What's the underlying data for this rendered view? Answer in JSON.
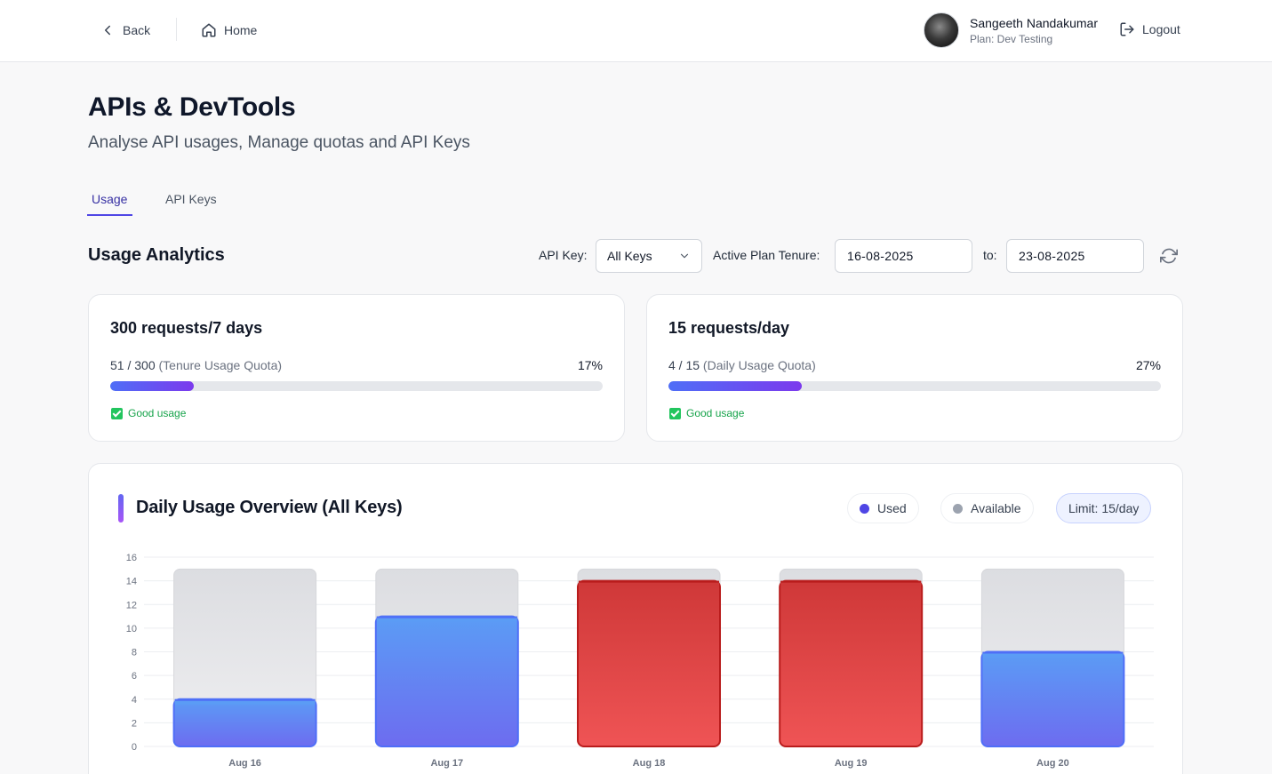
{
  "nav": {
    "back_label": "Back",
    "home_label": "Home",
    "user_name": "Sangeeth Nandakumar",
    "user_plan": "Plan: Dev Testing",
    "logout_label": "Logout"
  },
  "page": {
    "title": "APIs & DevTools",
    "subtitle": "Analyse API usages, Manage quotas and API Keys"
  },
  "tabs": [
    {
      "label": "Usage",
      "active": true
    },
    {
      "label": "API Keys",
      "active": false
    }
  ],
  "analytics": {
    "title": "Usage Analytics",
    "api_key_label": "API Key:",
    "api_key_value": "All Keys",
    "tenure_label": "Active Plan Tenure:",
    "from_date": "16-08-2025",
    "to_label": "to:",
    "to_date": "23-08-2025"
  },
  "cards": [
    {
      "title": "300 requests/7 days",
      "used": "51 / 300",
      "quota_label": "(Tenure Usage Quota)",
      "percent_label": "17%",
      "percent": 17,
      "status": "Good usage"
    },
    {
      "title": "15 requests/day",
      "used": "4 / 15",
      "quota_label": "(Daily Usage Quota)",
      "percent_label": "27%",
      "percent": 27,
      "status": "Good usage"
    }
  ],
  "daily_chart": {
    "title": "Daily Usage Overview (All Keys)",
    "legend_used": "Used",
    "legend_available": "Available",
    "limit_label": "Limit: 15/day"
  },
  "colors": {
    "used": "#4f6ef7",
    "available": "#9ca3af",
    "over": "#dc2626",
    "accent": "#4f46e5",
    "good": "#16a34a"
  },
  "chart_data": {
    "type": "bar",
    "stacked": true,
    "categories": [
      "Aug 16",
      "Aug 17",
      "Aug 18",
      "Aug 19",
      "Aug 20"
    ],
    "series": [
      {
        "name": "Used",
        "values": [
          4,
          11,
          14,
          14,
          8
        ]
      },
      {
        "name": "Available",
        "values": [
          11,
          4,
          1,
          1,
          7
        ]
      }
    ],
    "high_usage_days": [
      "Aug 18",
      "Aug 19"
    ],
    "y_ticks": [
      0,
      2,
      4,
      6,
      8,
      10,
      12,
      14,
      16
    ],
    "ylim": [
      0,
      16
    ],
    "grid": true,
    "legend": "top-right"
  }
}
